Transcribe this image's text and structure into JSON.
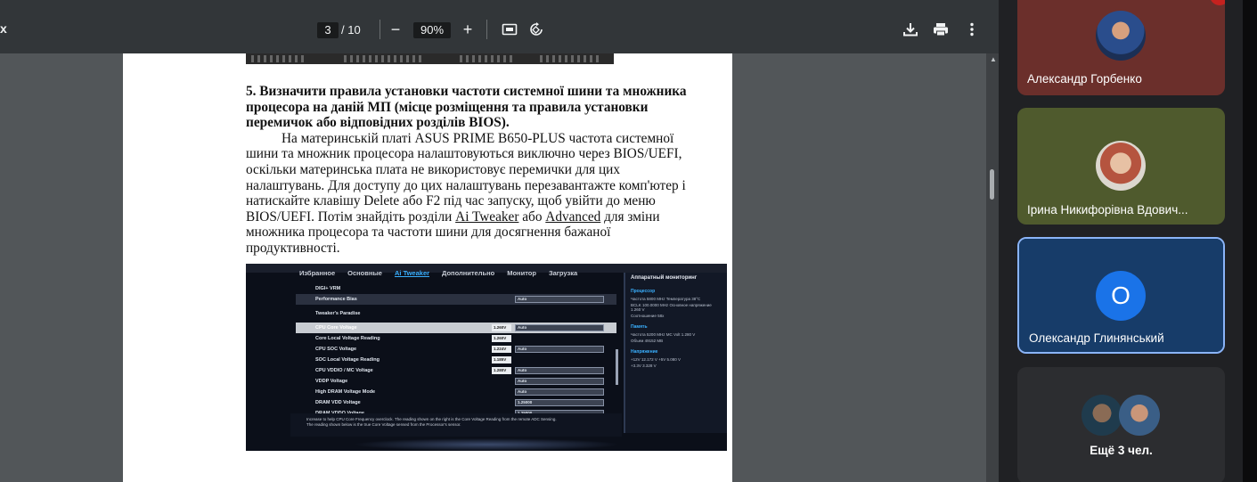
{
  "toolbar": {
    "file_name_fragment": "x",
    "current_page": "3",
    "total_pages": "/ 10",
    "zoom_out": "−",
    "zoom_level": "90%",
    "zoom_in": "+",
    "icons": [
      "fit-page-icon",
      "rotate-icon",
      "download-icon",
      "print-icon",
      "more-vert-icon"
    ]
  },
  "document": {
    "heading": "5. Визначити правила установки частоти системної шини та множника процесора на даній МП (місце розміщення та правила установки перемичок або відповідних розділів BIOS).",
    "paragraph_part1": "На материнській платі ASUS PRIME B650-PLUS частота системної шини та множник процесора налаштовуються виключно через BIOS/UEFI, оскільки материнська плата не використовує перемички для цих налаштувань. Для доступу до цих налаштувань перезавантажте комп'ютер і натискайте клавішу Delete або F2 під час запуску, щоб увійти до меню BIOS/UEFI. Потім знайдіть розділи ",
    "link_ai_tweaker": "Ai Tweaker",
    "paragraph_part2": "  або ",
    "link_advanced": "Advanced",
    "paragraph_part3": " для зміни множника процесора та частоти шини для досягнення бажаної продуктивності."
  },
  "bios_photo": {
    "tabs": [
      "Избранное",
      "Основные",
      "Ai Tweaker",
      "Дополнительно",
      "Монитор",
      "Загрузка"
    ],
    "active_tab": "Ai Tweaker",
    "rows": [
      {
        "label": "DIGI+ VRM",
        "value": "",
        "dropdown": ""
      },
      {
        "label": "Performance Bias",
        "value": "",
        "dropdown": "Auto"
      },
      {
        "label": "Tweaker's Paradise",
        "value": "",
        "dropdown": ""
      },
      {
        "label": "CPU Core Voltage",
        "value": "1.260V",
        "dropdown": "Auto"
      },
      {
        "label": "Core Local Voltage Reading",
        "value": "1.260V",
        "dropdown": ""
      },
      {
        "label": "CPU SOC Voltage",
        "value": "1.224V",
        "dropdown": "Auto"
      },
      {
        "label": "SOC Local Voltage Reading",
        "value": "1.185V",
        "dropdown": ""
      },
      {
        "label": "CPU VDDIO / MC Voltage",
        "value": "1.280V",
        "dropdown": "Auto"
      },
      {
        "label": "VDDP Voltage",
        "value": "",
        "dropdown": "Auto"
      },
      {
        "label": "High DRAM Voltage Mode",
        "value": "",
        "dropdown": "Auto"
      },
      {
        "label": "DRAM VDD Voltage",
        "value": "",
        "dropdown": "1.25000"
      },
      {
        "label": "DRAM VDDQ Voltage",
        "value": "",
        "dropdown": "1.25000"
      }
    ],
    "side_title": "Аппаратный мониторинг",
    "side_sections": [
      {
        "title": "Процессор",
        "lines": [
          "Частота 5800 MHz   Температура 38°C",
          "BCLK 100.0000 MHz   Основное напряжение 1.260 V",
          "Соотношение 58x"
        ]
      },
      {
        "title": "Память",
        "lines": [
          "Частота 5200 MHz   MC Volt 1.280 V",
          "Объем 49152 MB"
        ]
      },
      {
        "title": "Напряжение",
        "lines": [
          "+12V 12.172 V   +5V 5.080 V",
          "+3.3V 3.328 V"
        ]
      }
    ],
    "help_line1": "Increase to help CPU Core Frequency overclock. The reading shown on the right is the Core Voltage Reading from the remote ADC Sensing.",
    "help_line2": "The reading shown below is the true Core Voltage sensed from the Processor's sensor."
  },
  "participants": [
    {
      "name": "Александр Горбенко",
      "tile_color": "#6b2f2b",
      "avatar_type": "photo"
    },
    {
      "name": "Ірина Никифорівна Вдович...",
      "tile_color": "#4f5a2d",
      "avatar_type": "photo"
    },
    {
      "name": "Олександр Глинянський",
      "tile_color": "#173c69",
      "avatar_type": "initial",
      "initial": "О",
      "avatar_color": "#1a73e8",
      "active_speaker": true
    },
    {
      "name": "Ещё 3 чел.",
      "tile_color": "#2c2d30",
      "avatar_type": "group"
    }
  ]
}
